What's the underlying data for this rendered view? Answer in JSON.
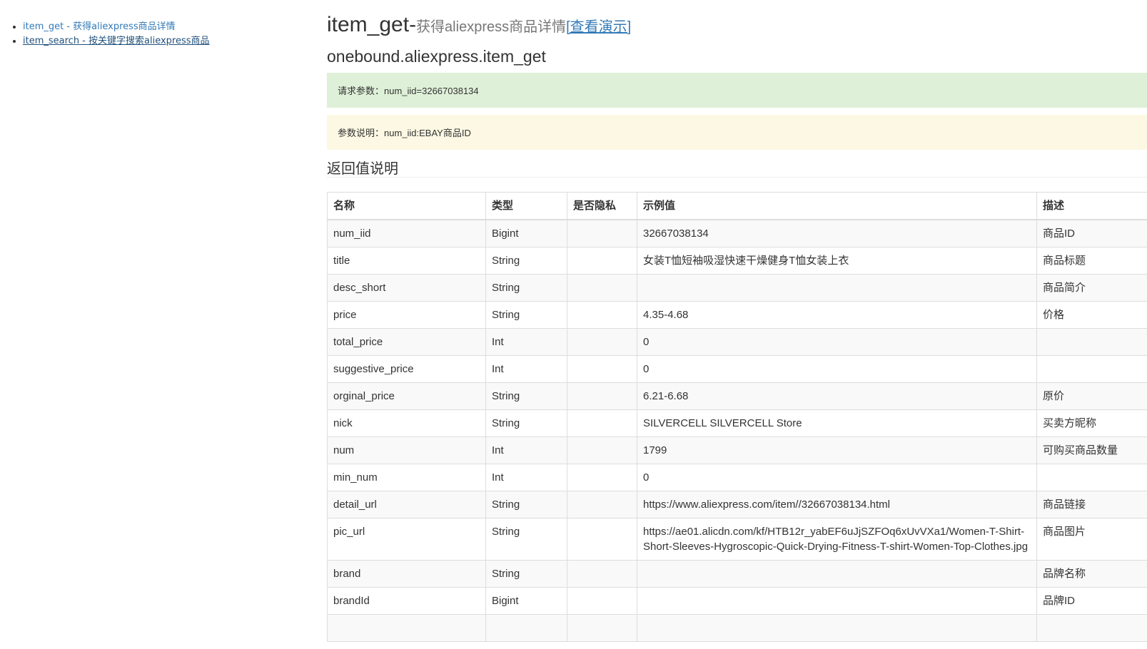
{
  "sidebar": {
    "items": [
      {
        "label": "item_get - 获得aliexpress商品详情"
      },
      {
        "label": "item_search - 按关键字搜索aliexpress商品"
      }
    ]
  },
  "header": {
    "title_main": "item_get-",
    "title_sub": "获得aliexpress商品详情",
    "demo_link": "[查看演示]",
    "api_name": "onebound.aliexpress.item_get"
  },
  "alerts": {
    "request_params": "请求参数：num_iid=32667038134",
    "param_desc": "参数说明：num_iid:EBAY商品ID"
  },
  "section": {
    "title": "返回值说明"
  },
  "table": {
    "headers": [
      "名称",
      "类型",
      "是否隐私",
      "示例值",
      "描述"
    ],
    "rows": [
      {
        "name": "num_iid",
        "type": "Bigint",
        "private": "",
        "example": "32667038134",
        "desc": "商品ID"
      },
      {
        "name": "title",
        "type": "String",
        "private": "",
        "example": "女装T恤短袖吸湿快速干燥健身T恤女装上衣",
        "desc": "商品标题"
      },
      {
        "name": "desc_short",
        "type": "String",
        "private": "",
        "example": "",
        "desc": "商品简介"
      },
      {
        "name": "price",
        "type": "String",
        "private": "",
        "example": "4.35-4.68",
        "desc": "价格"
      },
      {
        "name": "total_price",
        "type": "Int",
        "private": "",
        "example": "0",
        "desc": ""
      },
      {
        "name": "suggestive_price",
        "type": "Int",
        "private": "",
        "example": "0",
        "desc": ""
      },
      {
        "name": "orginal_price",
        "type": "String",
        "private": "",
        "example": "6.21-6.68",
        "desc": "原价"
      },
      {
        "name": "nick",
        "type": "String",
        "private": "",
        "example": "SILVERCELL SILVERCELL Store",
        "desc": "买卖方昵称"
      },
      {
        "name": "num",
        "type": "Int",
        "private": "",
        "example": "1799",
        "desc": "可购买商品数量"
      },
      {
        "name": "min_num",
        "type": "Int",
        "private": "",
        "example": "0",
        "desc": ""
      },
      {
        "name": "detail_url",
        "type": "String",
        "private": "",
        "example": "https://www.aliexpress.com/item//32667038134.html",
        "desc": "商品链接"
      },
      {
        "name": "pic_url",
        "type": "String",
        "private": "",
        "example": "https://ae01.alicdn.com/kf/HTB12r_yabEF6uJjSZFOq6xUvVXa1/Women-T-Shirt-Short-Sleeves-Hygroscopic-Quick-Drying-Fitness-T-shirt-Women-Top-Clothes.jpg",
        "desc": "商品图片"
      },
      {
        "name": "brand",
        "type": "String",
        "private": "",
        "example": "",
        "desc": "品牌名称"
      },
      {
        "name": "brandId",
        "type": "Bigint",
        "private": "",
        "example": "",
        "desc": "品牌ID"
      },
      {
        "name": "",
        "type": "",
        "private": "",
        "example": "",
        "desc": ""
      }
    ]
  }
}
